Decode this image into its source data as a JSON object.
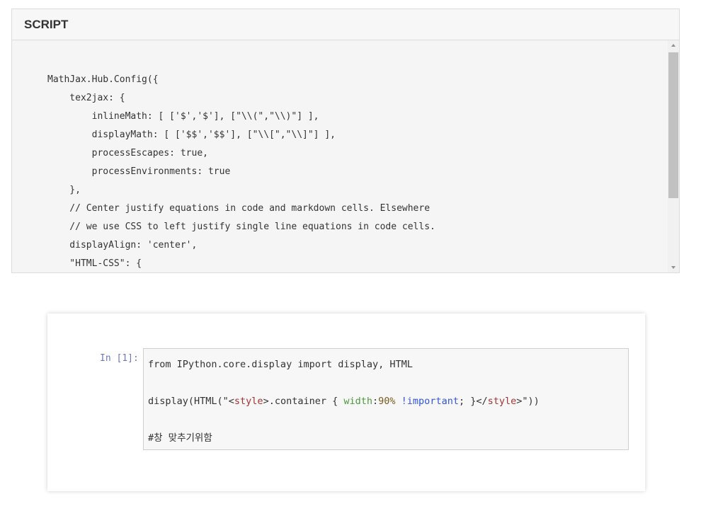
{
  "script_panel": {
    "title": "SCRIPT",
    "lines": [
      "MathJax.Hub.Config({",
      "    tex2jax: {",
      "        inlineMath: [ ['$','$'], [\"\\\\(\",\"\\\\)\"] ],",
      "        displayMath: [ ['$$','$$'], [\"\\\\[\",\"\\\\]\"] ],",
      "        processEscapes: true,",
      "        processEnvironments: true",
      "    },",
      "    // Center justify equations in code and markdown cells. Elsewhere",
      "    // we use CSS to left justify single line equations in code cells.",
      "    displayAlign: 'center',",
      "    \"HTML-CSS\": {"
    ]
  },
  "notebook_cell": {
    "prompt": "In [1]:",
    "line1": "from IPython.core.display import display, HTML",
    "line2": {
      "p1": "display(HTML(\"<",
      "tag_open": "style",
      "p2": ">.container { ",
      "prop": "width",
      "p3": ":",
      "num": "90%",
      "p4": " ",
      "imp": "!important",
      "p5": "; }</",
      "tag_close": "style",
      "p6": ">\"))"
    },
    "line3": "#창 맞추기위함"
  }
}
